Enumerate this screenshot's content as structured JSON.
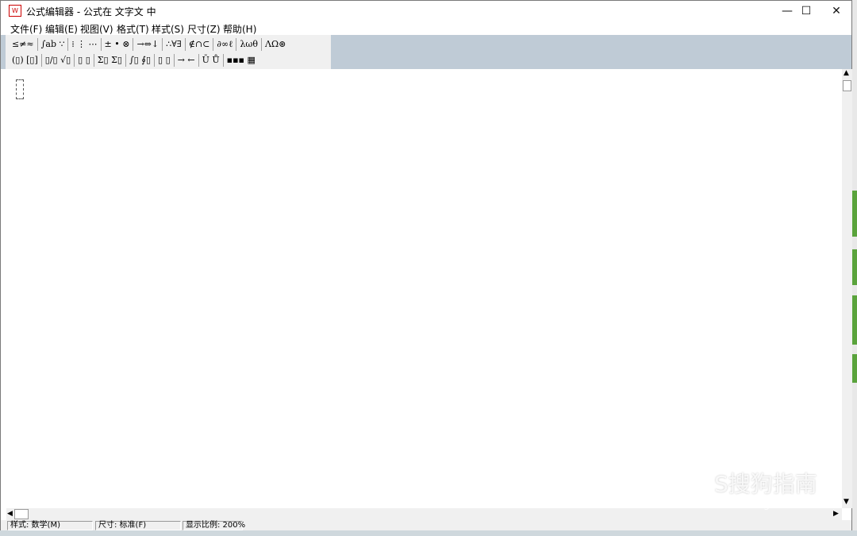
{
  "window": {
    "title": "公式编辑器 - 公式在 文字文 中",
    "icon_text": "W",
    "controls": {
      "minimize": "—",
      "maximize": "☐",
      "close": "✕"
    }
  },
  "menu": [
    "文件(F)",
    "编辑(E)",
    "视图(V)",
    "格式(T)",
    "样式(S)",
    "尺寸(Z)",
    "帮助(H)"
  ],
  "toolbar": {
    "row1": [
      "≤≠≈",
      "∫ab ∵",
      "⁞ ⋮ ⋯",
      "± • ⊗",
      "→⇔↓",
      "∴∀∃",
      "∉∩⊂",
      "∂∞ℓ",
      "λωθ",
      "ΛΩ⊛"
    ],
    "row2": [
      "(▯) [▯]",
      "▯/▯ √▯",
      "▯ ▯",
      "Σ▯ Σ▯",
      "∫▯ ∮▯",
      "▯ ▯",
      "→ ←",
      "Ū Ů",
      "▪▪▪ ▦"
    ]
  },
  "scroll": {
    "up": "▲",
    "down": "▼",
    "left": "◀",
    "right": "▶"
  },
  "status": {
    "style": "样式: 数学(M)",
    "size": "尺寸: 标准(F)",
    "zoom": "显示比例: 200%"
  },
  "watermark": {
    "text": "S搜狗指南",
    "sub": "zhinan.sogou.com"
  },
  "colors": {
    "toolbar_bg": "#bfcbd6",
    "desktop": "#2a6f97",
    "green_accent": "#5aa33c"
  }
}
